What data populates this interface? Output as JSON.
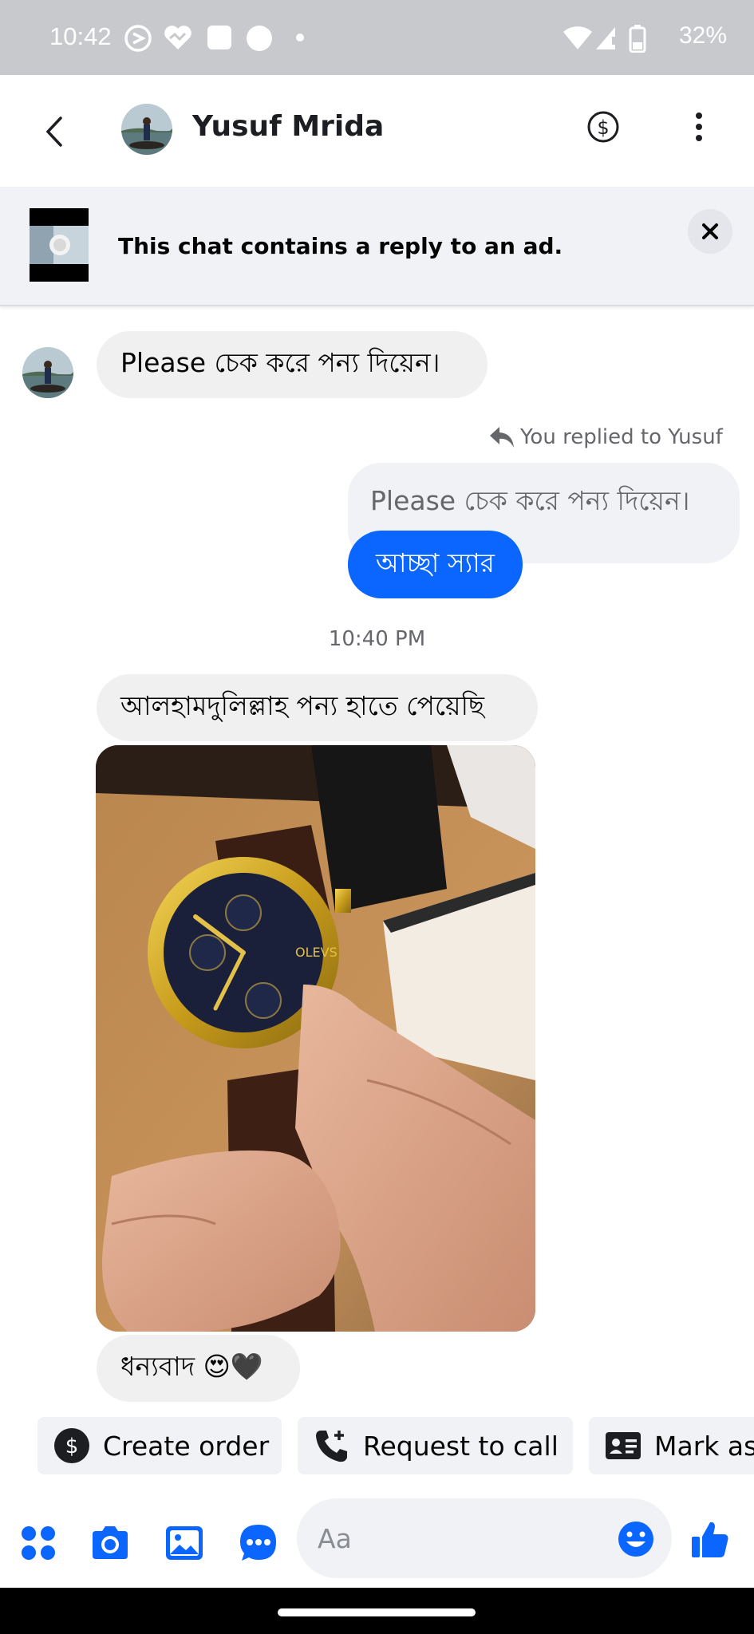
{
  "status_bar": {
    "time": "10:42",
    "battery": "32%",
    "icons": [
      "assistant-icon",
      "health-icon",
      "square-icon",
      "circle-icon",
      "dot-icon",
      "wifi-icon",
      "signal-icon",
      "battery-icon"
    ]
  },
  "header": {
    "contact_name": "Yusuf Mrida",
    "back_icon": "chevron-left-icon",
    "payment_icon": "dollar-circle-icon",
    "menu_icon": "more-vertical-icon"
  },
  "ad_banner": {
    "text": "This chat contains a reply to an ad.",
    "close_icon": "close-icon"
  },
  "messages": [
    {
      "from": "Yusuf Mrida",
      "text": "Please চেক করে পন্য দিয়েন।"
    },
    {
      "from": "me",
      "reply_note": "You replied to Yusuf",
      "quoted": "Please চেক করে পন্য দিয়েন।",
      "text": "আচ্ছা স্যার"
    },
    {
      "divider": "10:40 PM"
    },
    {
      "from": "Yusuf Mrida",
      "text": "আলহামদুলিল্লাহ পন্য হাতে পেয়েছি"
    },
    {
      "from": "Yusuf Mrida",
      "type": "photo",
      "subject": "gold wristwatch with brown leather strap"
    },
    {
      "from": "Yusuf Mrida",
      "text": "ধন্যবাদ 😍🖤"
    }
  ],
  "quick_actions": [
    {
      "label": "Create order",
      "icon": "dollar-circle-icon"
    },
    {
      "label": "Request to call",
      "icon": "phone-plus-icon"
    },
    {
      "label": "Mark as",
      "icon": "contact-card-icon"
    }
  ],
  "composer": {
    "placeholder": "Aa",
    "icons": [
      "apps-grid-icon",
      "camera-icon",
      "gallery-icon",
      "chat-bubble-icon",
      "emoji-icon",
      "thumbs-up-icon"
    ]
  },
  "colors": {
    "accent": "#0a66ff",
    "bubble_incoming": "#f0f0f0",
    "status_bar": "#c8c9cd"
  }
}
